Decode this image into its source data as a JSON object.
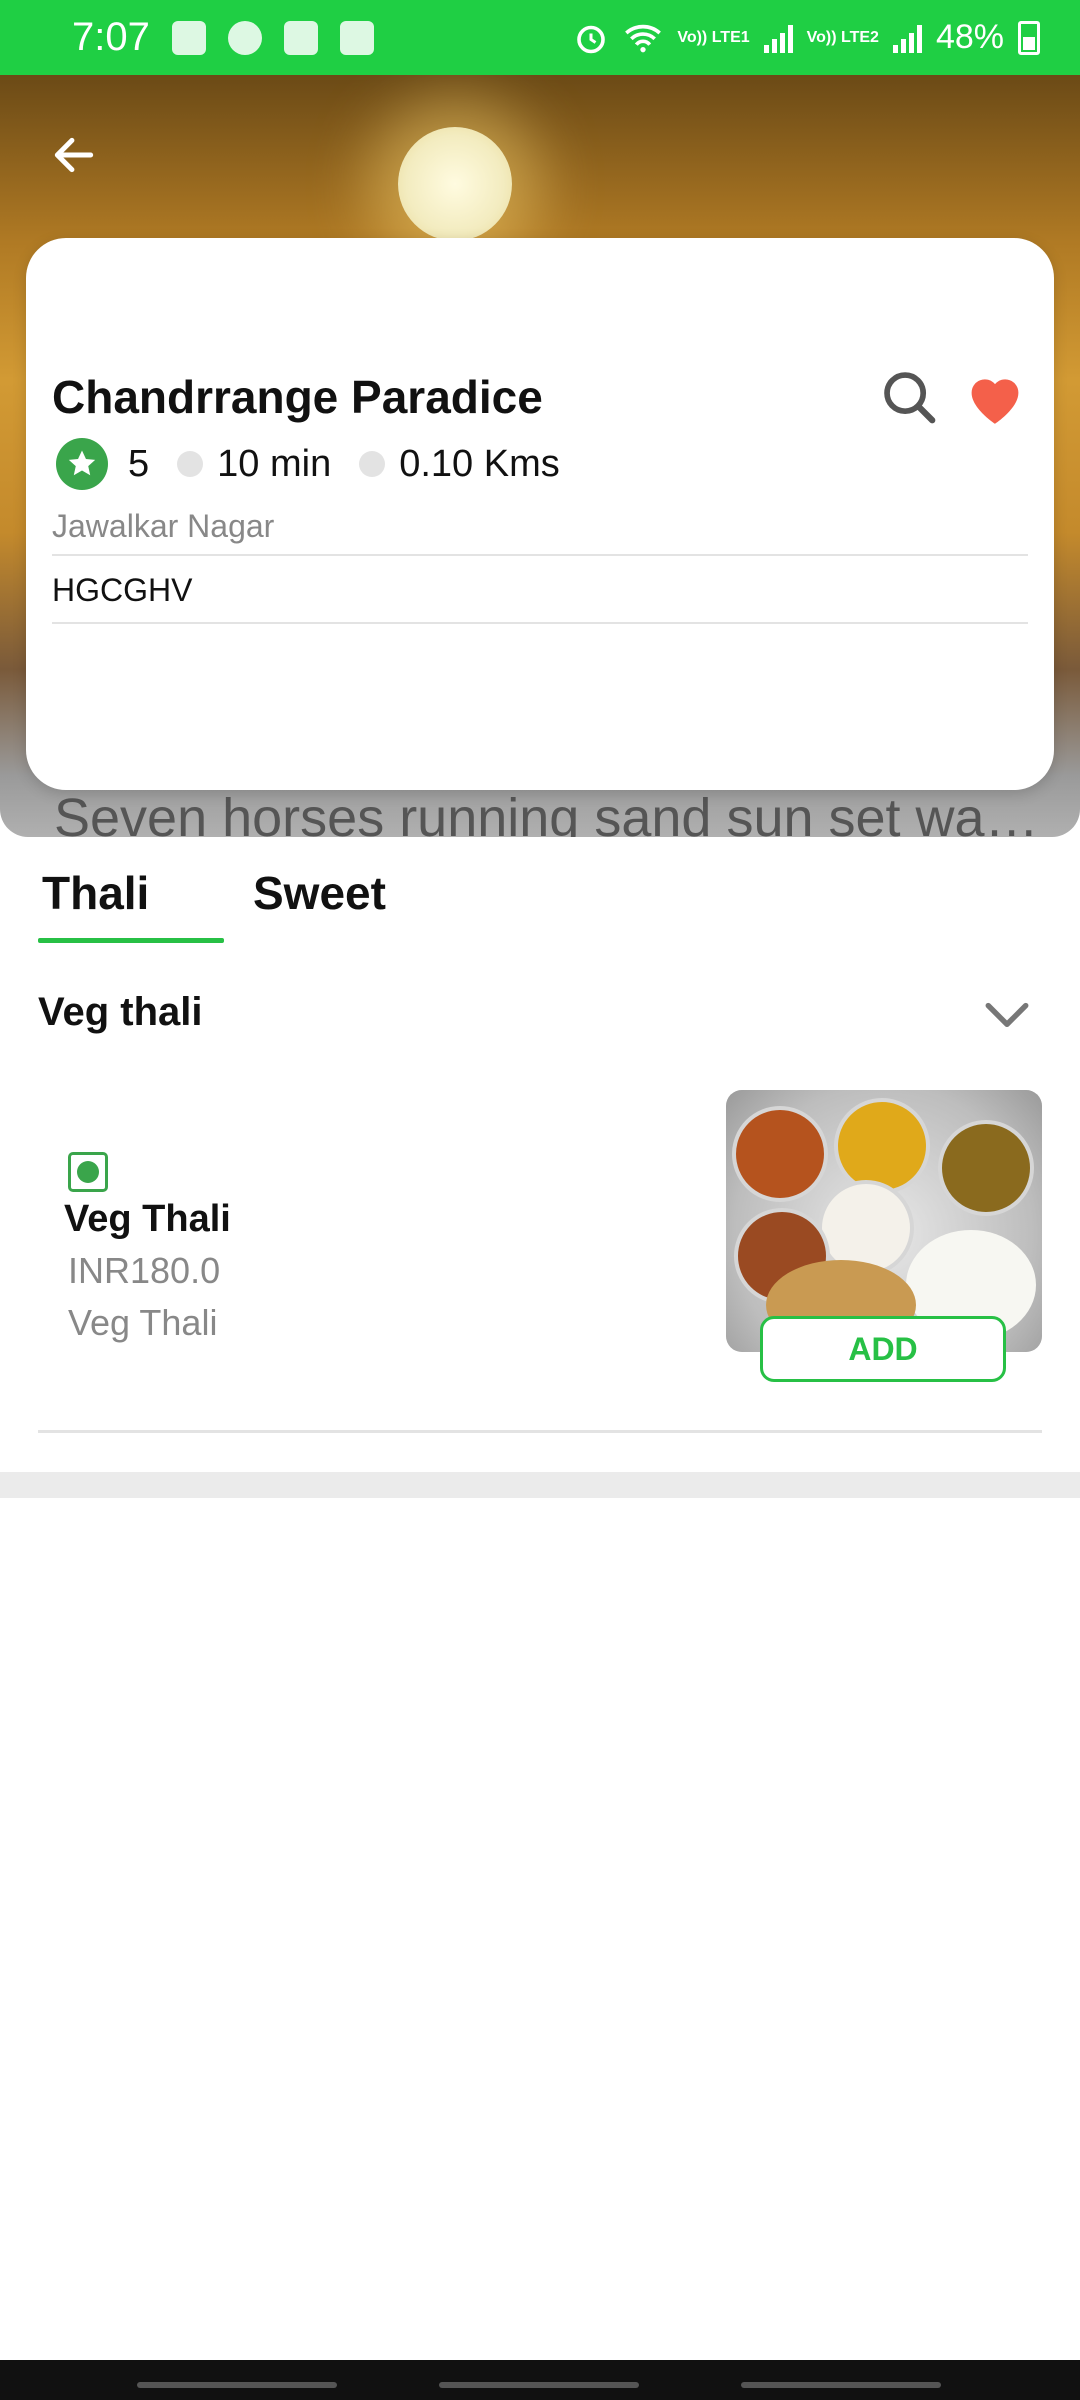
{
  "status_bar": {
    "time": "7:07",
    "battery": "48%",
    "sim1_label": "Vo)) LTE1",
    "sim2_label": "Vo)) LTE2",
    "icons": [
      "teams-icon",
      "bluetooth-icon",
      "cloud-upload-icon",
      "gallery-icon",
      "alarm-icon",
      "wifi-icon",
      "signal-icon",
      "battery-icon"
    ]
  },
  "hero": {
    "caption": "Seven horses running sand sun set wall..."
  },
  "restaurant": {
    "name": "Chandrrange Paradice",
    "rating": "5",
    "time": "10 min",
    "distance": "0.10 Kms",
    "area": "Jawalkar Nagar",
    "code": "HGCGHV"
  },
  "tabs": [
    {
      "label": "Thali",
      "active": true
    },
    {
      "label": "Sweet",
      "active": false
    }
  ],
  "category": {
    "title": "Veg thali"
  },
  "menu_items": [
    {
      "name": "Veg Thali",
      "price": "INR180.0",
      "description": "Veg Thali",
      "add_label": "ADD"
    }
  ],
  "colors": {
    "accent": "#27c045",
    "status_bar": "#1fcf44",
    "heart": "#f4604a",
    "rating": "#3aa54b"
  }
}
